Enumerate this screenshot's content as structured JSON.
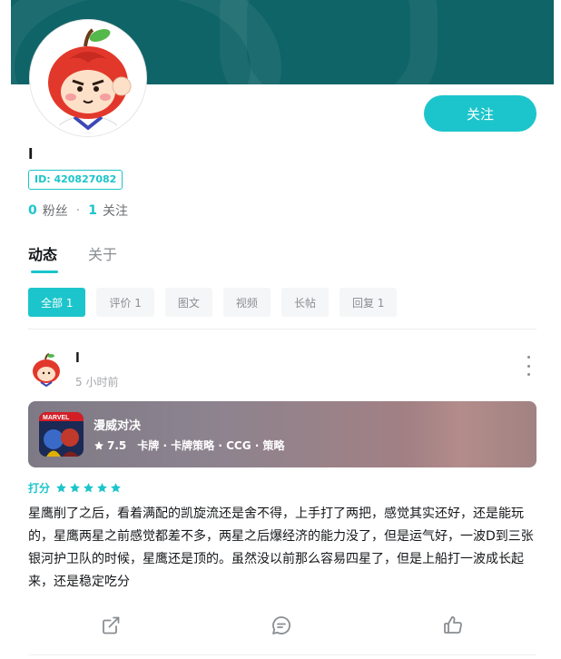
{
  "profile": {
    "name": "l",
    "id_label": "ID: 420827082",
    "follow_label": "关注",
    "fans_count": "0",
    "fans_label": "粉丝",
    "following_count": "1",
    "following_label": "关注"
  },
  "tabs": [
    {
      "label": "动态",
      "active": true
    },
    {
      "label": "关于",
      "active": false
    }
  ],
  "filters": [
    {
      "label": "全部 1",
      "active": true
    },
    {
      "label": "评价 1",
      "active": false
    },
    {
      "label": "图文",
      "active": false
    },
    {
      "label": "视频",
      "active": false
    },
    {
      "label": "长帖",
      "active": false
    },
    {
      "label": "回复 1",
      "active": false
    }
  ],
  "post": {
    "author": "l",
    "time": "5 小时前",
    "game": {
      "name": "漫威对决",
      "score": "7.5",
      "tags": "卡牌 · 卡牌策略 · CCG · 策略",
      "icon_text": "MARVEL"
    },
    "rating_label": "打分",
    "rating_stars": 5,
    "review_text": "星鹰削了之后，看着满配的凯旋流还是舍不得，上手打了两把，感觉其实还好，还是能玩的，星鹰两星之前感觉都差不多，两星之后爆经济的能力没了，但是运气好，一波D到三张银河护卫队的时候，星鹰还是顶的。虽然没以前那么容易四星了，但是上船打一波成长起来，还是稳定吃分"
  },
  "icons": {
    "share": "share-icon",
    "comment": "comment-icon",
    "like": "thumbs-up-icon",
    "more": "more-vertical-icon",
    "star": "star-icon"
  },
  "colors": {
    "accent": "#1cc5cb",
    "banner": "#0f6468",
    "text": "#15171a",
    "muted": "#8a8e92"
  }
}
